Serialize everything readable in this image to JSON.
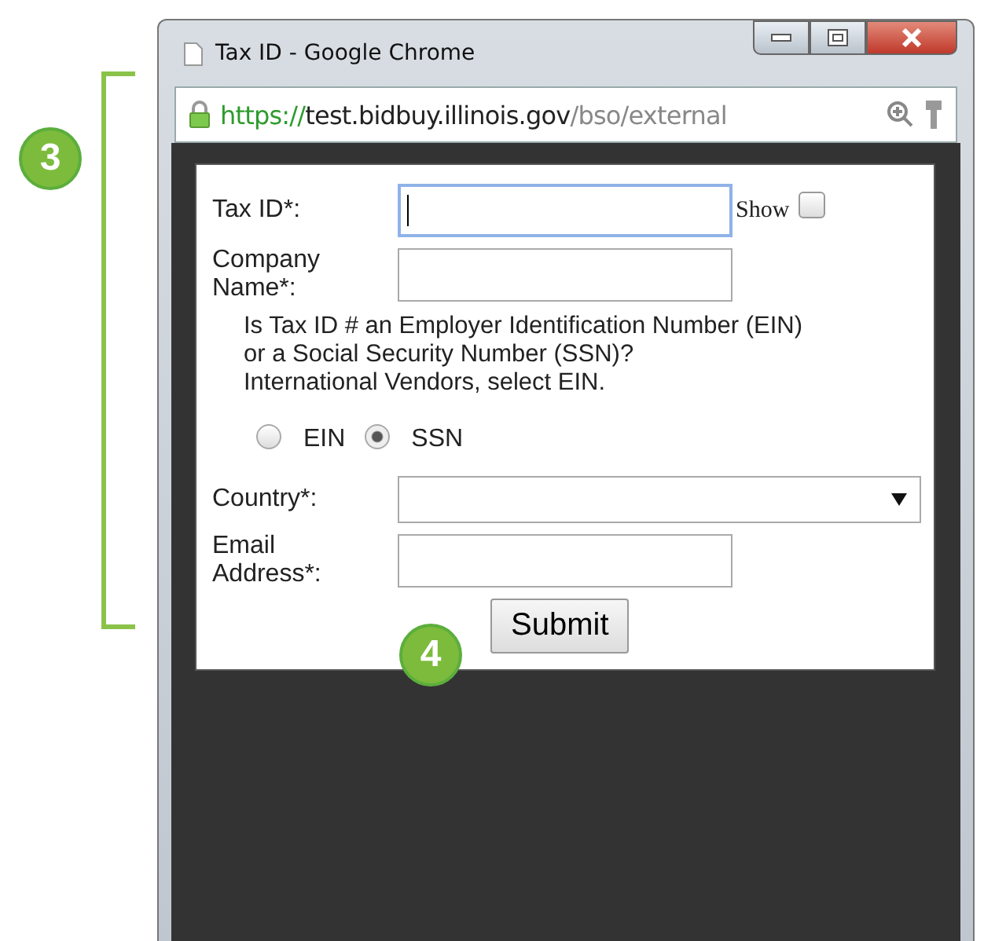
{
  "window": {
    "title": "Tax ID - Google Chrome"
  },
  "address_bar": {
    "scheme": "https://",
    "host": "test.bidbuy.illinois.gov",
    "path": "/bso/external"
  },
  "form": {
    "fields": [
      {
        "kind": "text",
        "label": "Tax ID*:",
        "focused": true,
        "show": {
          "label": "Show",
          "checked": false
        }
      },
      {
        "kind": "text",
        "label": "Company Name*:",
        "focused": false
      },
      {
        "kind": "question",
        "lines": [
          "Is Tax ID # an Employer Identification Number (EIN)",
          "or a Social Security Number (SSN)?",
          "International Vendors, select EIN."
        ],
        "options": [
          {
            "label": "EIN",
            "selected": false
          },
          {
            "label": "SSN",
            "selected": true
          }
        ]
      },
      {
        "kind": "select",
        "label": "Country*:",
        "focused": false
      },
      {
        "kind": "text",
        "label": "Email Address*:",
        "focused": false
      }
    ],
    "submit": "Submit"
  },
  "callouts": [
    {
      "label": "3"
    },
    {
      "label": "4"
    }
  ]
}
